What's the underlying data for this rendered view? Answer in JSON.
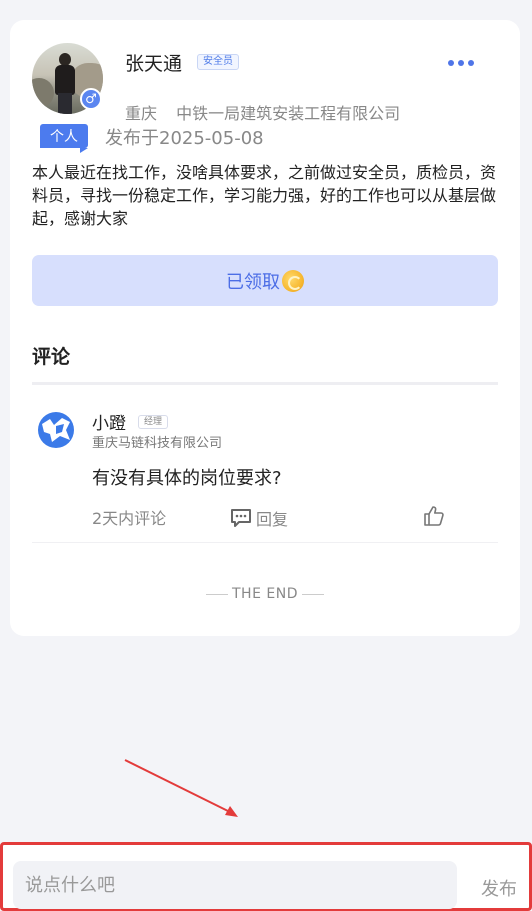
{
  "post": {
    "author_name": "张天通",
    "author_role": "安全员",
    "city": "重庆",
    "company": "中铁一局建筑安装工程有限公司",
    "type_tag": "个人",
    "posted": "发布于2025-05-08",
    "content": "本人最近在找工作，没啥具体要求，之前做过安全员，质检员，资料员，寻找一份稳定工作，学习能力强，好的工作也可以从基层做起，感谢大家",
    "claim_label": "已领取",
    "gender_symbol": "♂"
  },
  "comments": {
    "title": "评论",
    "items": [
      {
        "name": "小蹬",
        "role": "经理",
        "company": "重庆马链科技有限公司",
        "text": "有没有具体的岗位要求?",
        "time": "2天内评论",
        "reply_label": "回复"
      }
    ],
    "end_label": "THE END"
  },
  "bottom": {
    "placeholder": "说点什么吧",
    "publish_label": "发布"
  },
  "colors": {
    "accent": "#4c7bee",
    "claim_bg": "#d7dffd",
    "highlight_border": "#e33b3b"
  }
}
